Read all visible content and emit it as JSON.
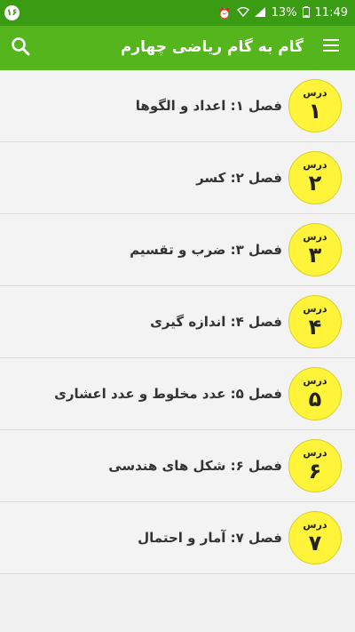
{
  "status_bar": {
    "notification_badge": "۱۶",
    "battery": "13%",
    "time": "11:49"
  },
  "app_bar": {
    "title": "گام به گام ریاضی چهارم"
  },
  "lessons": [
    {
      "badge_label": "درس",
      "number": "۱",
      "title": "فصل ۱: اعداد و الگوها"
    },
    {
      "badge_label": "درس",
      "number": "۲",
      "title": "فصل ۲: کسر"
    },
    {
      "badge_label": "درس",
      "number": "۳",
      "title": "فصل ۳: ضرب و تقسیم"
    },
    {
      "badge_label": "درس",
      "number": "۴",
      "title": "فصل ۴: اندازه گیری"
    },
    {
      "badge_label": "درس",
      "number": "۵",
      "title": "فصل ۵: عدد مخلوط و عدد اعشاری"
    },
    {
      "badge_label": "درس",
      "number": "۶",
      "title": "فصل ۶: شکل های هندسی"
    },
    {
      "badge_label": "درس",
      "number": "۷",
      "title": "فصل ۷: آمار و احتمال"
    }
  ],
  "colors": {
    "status_bar": "#3a9c13",
    "app_bar": "#54b61c",
    "badge": "#fff43a"
  }
}
